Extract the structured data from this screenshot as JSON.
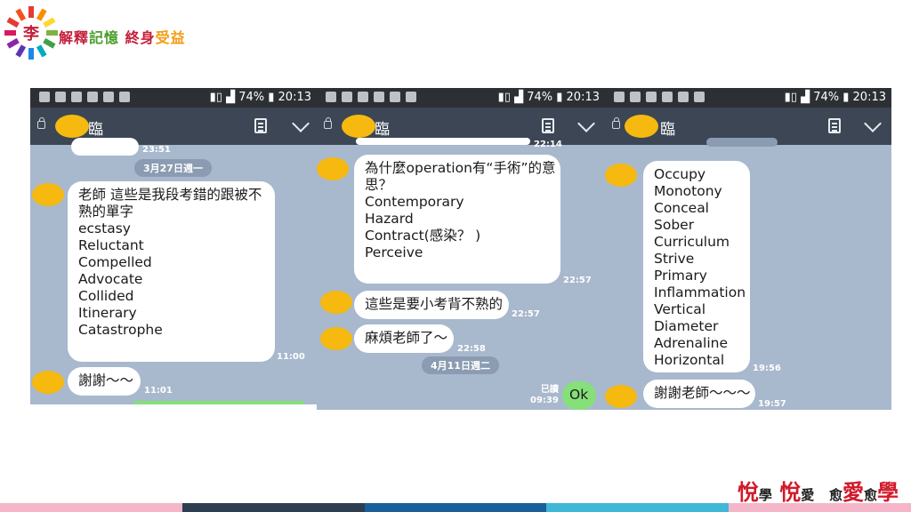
{
  "brand": {
    "logo_char": "李",
    "text_part1": "解釋",
    "text_part2": "記憶",
    "text_part3": "終身",
    "text_part4": "受益"
  },
  "status": {
    "battery": "74%",
    "time": "20:13"
  },
  "screens": [
    {
      "title": "臨",
      "messages": {
        "top_time": "23:51",
        "date": "3月27日週一",
        "msg1_lines": [
          "老師 這些是我段考錯的跟被不",
          "熟的單字",
          "ecstasy",
          "Reluctant",
          "Compelled",
          "Advocate",
          "Collided",
          "Itinerary",
          "Catastrophe"
        ],
        "msg1_time": "11:00",
        "msg2": "謝謝～～",
        "msg2_time": "11:01"
      }
    },
    {
      "title": "臨",
      "messages": {
        "top_time": "22:14",
        "msg1_lines": [
          "為什麼operation有“手術”的意",
          "思？",
          "Contemporary",
          "Hazard",
          "Contract(感染？ )",
          "Perceive"
        ],
        "msg1_time": "22:57",
        "msg2": "這些是要小考背不熟的",
        "msg2_time": "22:57",
        "msg3": "麻煩老師了～",
        "msg3_time": "22:58",
        "date": "4月11日週二",
        "read_label": "已讀",
        "reply_time": "09:39",
        "reply": "Ok"
      }
    },
    {
      "title": "臨",
      "messages": {
        "msg1_lines": [
          "Occupy",
          "Monotony",
          "Conceal",
          "Sober",
          "Curriculum",
          "Strive",
          "Primary",
          "Inflammation",
          "Vertical",
          "Diameter",
          "Adrenaline",
          "Horizontal"
        ],
        "msg1_time": "19:56",
        "msg2": "謝謝老師～～～",
        "msg2_time": "19:57"
      }
    }
  ],
  "slogan": {
    "c1": "悅",
    "c2": "學",
    "c3": "悅",
    "c4": "愛",
    "c5": "愈",
    "c6": "愛",
    "c7": "愈",
    "c8": "學"
  },
  "colors": {
    "line_bg": "#a8b8cd",
    "titlebar": "#3c4654",
    "statusbar": "#2c3035",
    "avatar": "#f5b910",
    "reply_bubble": "#85e07a",
    "footer": [
      "#f4b6c8",
      "#2d3e50",
      "#1a5f9a",
      "#3fb8d8",
      "#f4b6c8"
    ]
  }
}
